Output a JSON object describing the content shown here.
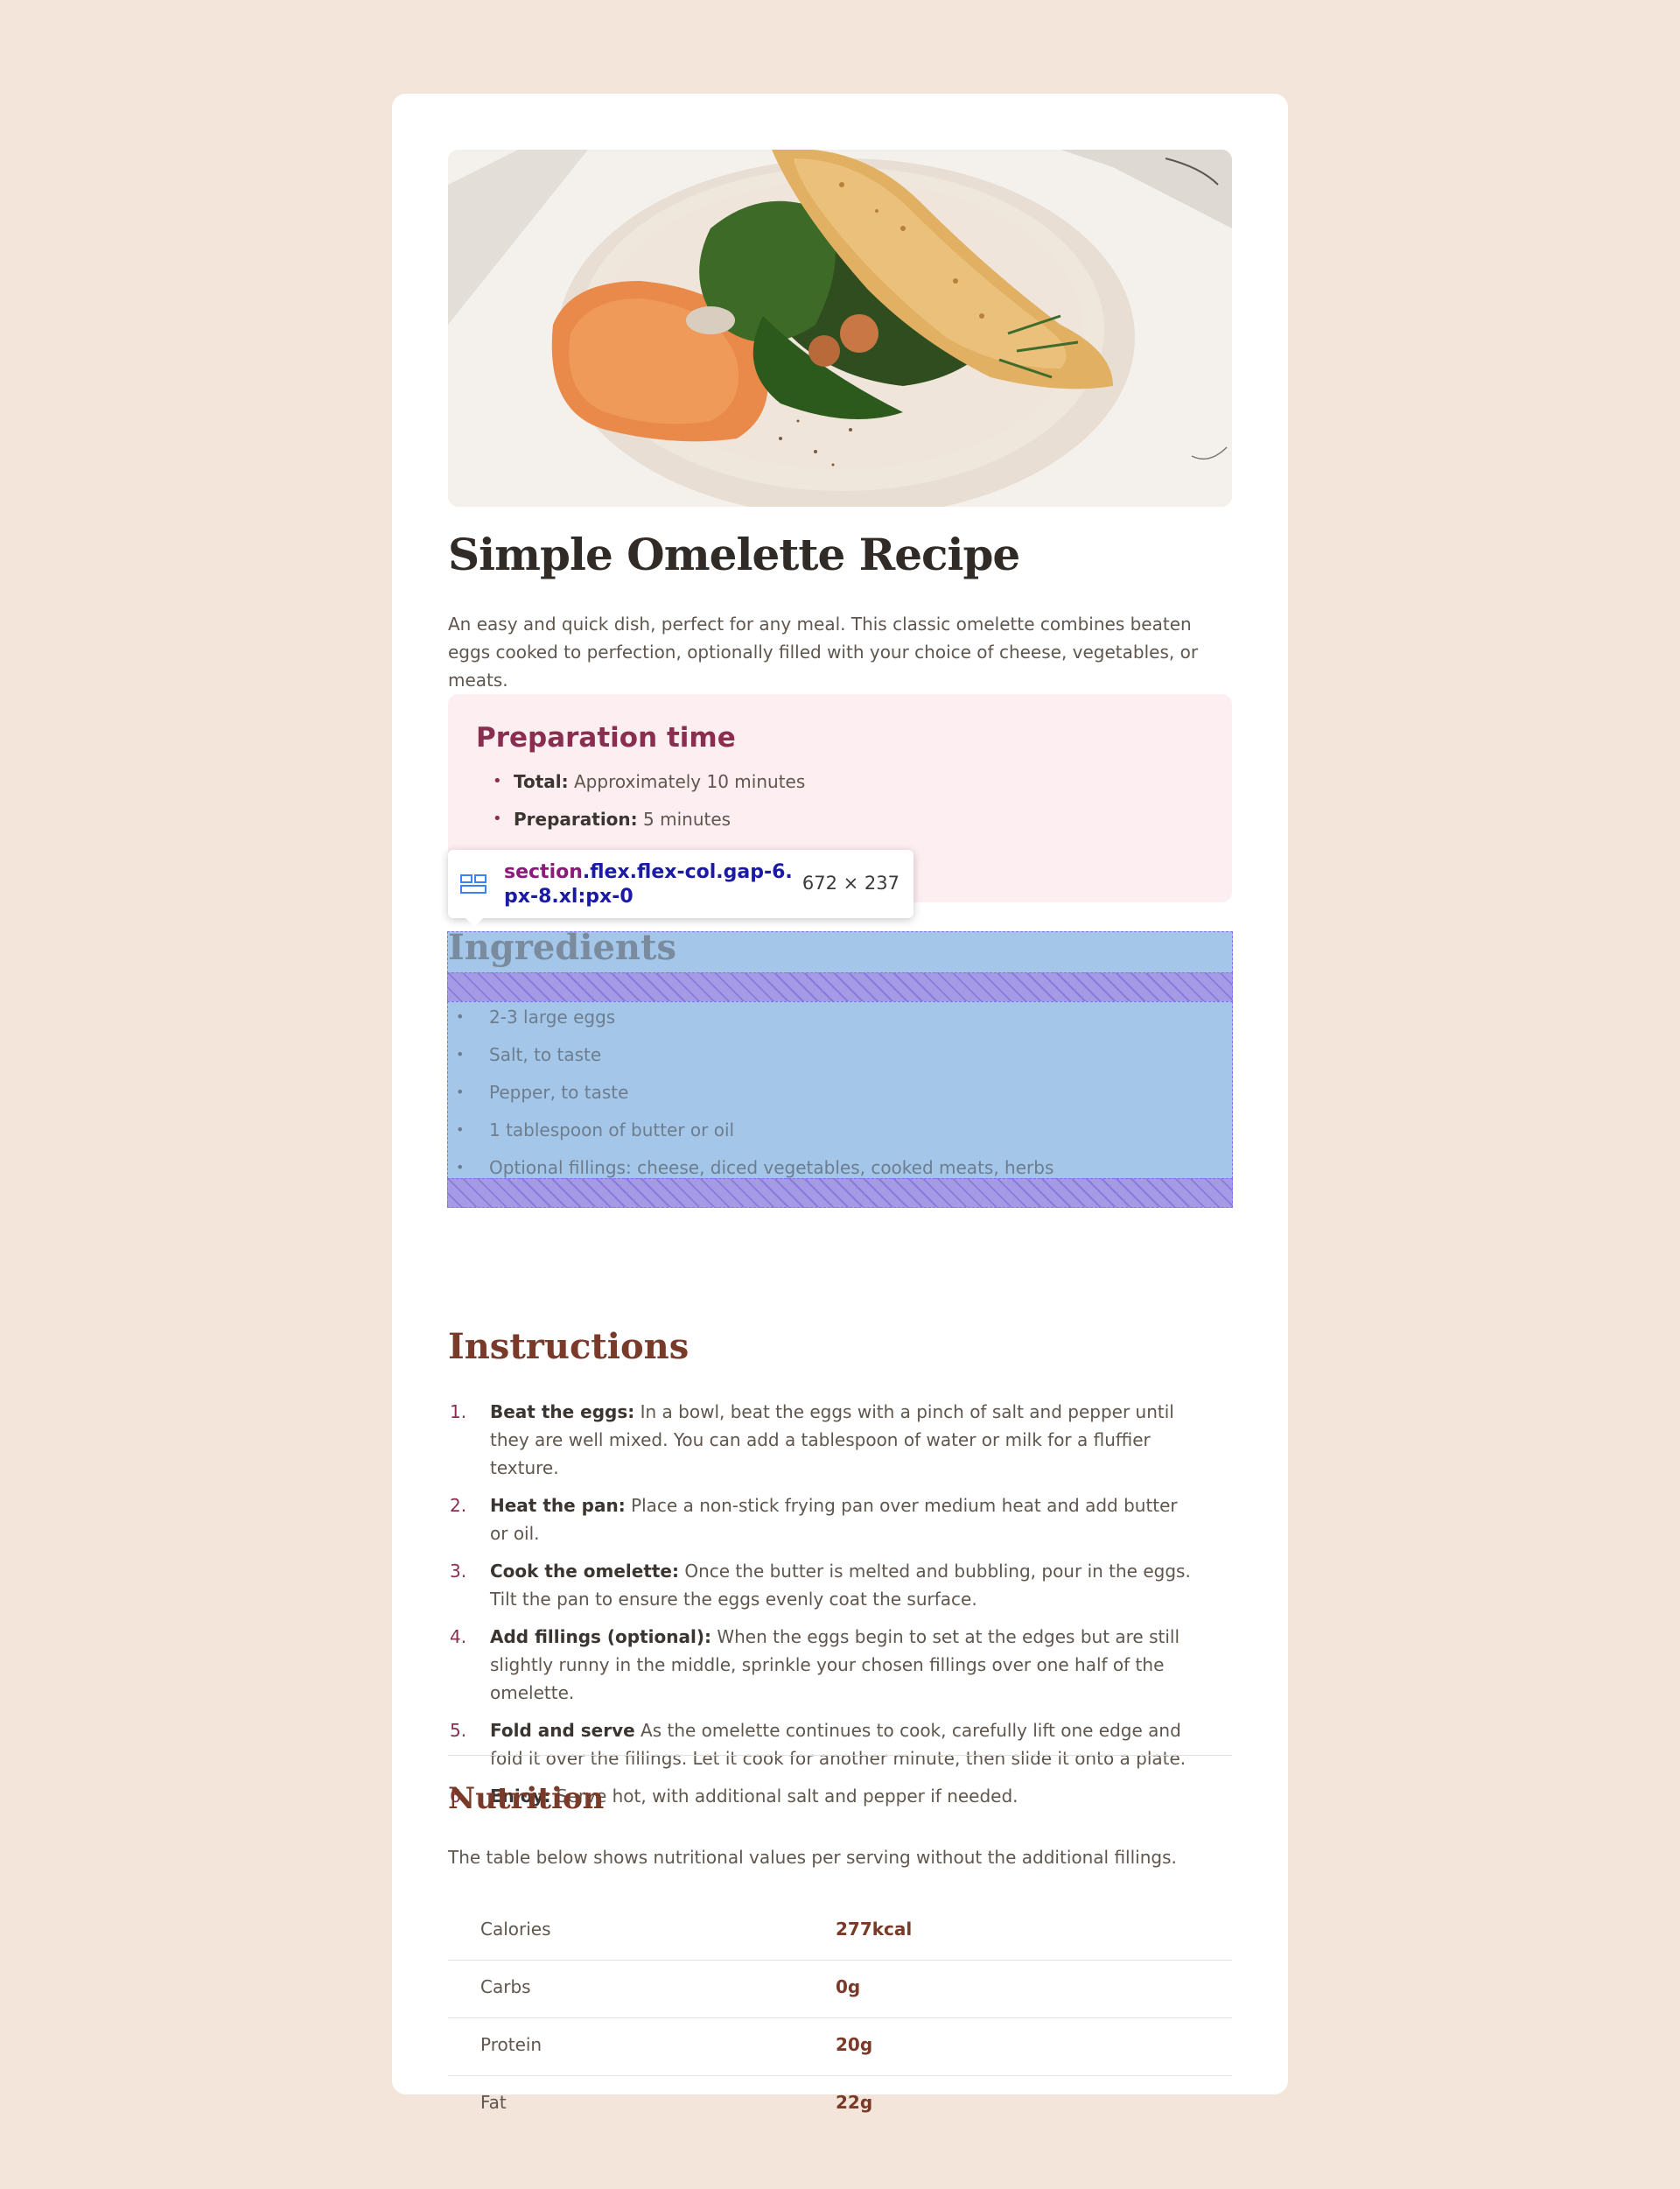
{
  "recipe": {
    "title": "Simple Omelette Recipe",
    "intro": "An easy and quick dish, perfect for any meal. This classic omelette combines beaten eggs cooked to perfection, optionally filled with your choice of cheese, vegetables, or meats."
  },
  "hero_image": {
    "alt": "Omelette on a plate with spinach and spread"
  },
  "preparation": {
    "title": "Preparation time",
    "items": [
      {
        "label": "Total:",
        "value": "Approximately 10 minutes"
      },
      {
        "label": "Preparation:",
        "value": "5 minutes"
      }
    ]
  },
  "ingredients": {
    "title": "Ingredients",
    "items": [
      "2-3 large eggs",
      "Salt, to taste",
      "Pepper, to taste",
      "1 tablespoon of butter or oil",
      "Optional fillings: cheese, diced vegetables, cooked meats, herbs"
    ]
  },
  "devtools_tooltip": {
    "tag": "section",
    "classes": ".flex.flex-col.gap-6.px-8.xl:px-0",
    "dimensions": "672 × 237"
  },
  "instructions": {
    "title": "Instructions",
    "steps": [
      {
        "num": "1.",
        "label": "Beat the eggs:",
        "text": "In a bowl, beat the eggs with a pinch of salt and pepper until they are well mixed. You can add a tablespoon of water or milk for a fluffier texture."
      },
      {
        "num": "2.",
        "label": "Heat the pan:",
        "text": "Place a non-stick frying pan over medium heat and add butter or oil."
      },
      {
        "num": "3.",
        "label": "Cook the omelette:",
        "text": "Once the butter is melted and bubbling, pour in the eggs. Tilt the pan to ensure the eggs evenly coat the surface."
      },
      {
        "num": "4.",
        "label": "Add fillings (optional):",
        "text": "When the eggs begin to set at the edges but are still slightly runny in the middle, sprinkle your chosen fillings over one half of the omelette."
      },
      {
        "num": "5.",
        "label": "Fold and serve",
        "text": "As the omelette continues to cook, carefully lift one edge and fold it over the fillings. Let it cook for another minute, then slide it onto a plate."
      },
      {
        "num": "6.",
        "label": "Enjoy:",
        "text": "Serve hot, with additional salt and pepper if needed."
      }
    ]
  },
  "nutrition": {
    "title": "Nutrition",
    "description": "The table below shows nutritional values per serving without the additional fillings.",
    "rows": [
      {
        "name": "Calories",
        "value": "277kcal"
      },
      {
        "name": "Carbs",
        "value": "0g"
      },
      {
        "name": "Protein",
        "value": "20g"
      },
      {
        "name": "Fat",
        "value": "22g"
      }
    ]
  },
  "colors": {
    "page_bg": "#f3e5d9",
    "card_bg": "#ffffff",
    "prep_bg": "#fdeef2",
    "prep_accent": "#8a2e4f",
    "heading_brown": "#7a3a2a",
    "highlight_blue": "#a3c6e9",
    "highlight_purple": "#a49ae6"
  },
  "icons": {
    "devtools_element": "layout-grid-icon"
  }
}
